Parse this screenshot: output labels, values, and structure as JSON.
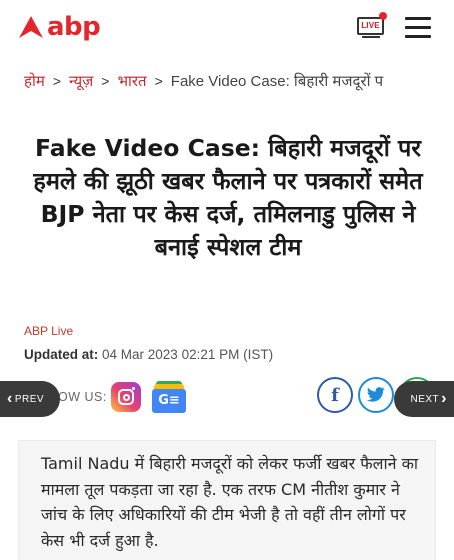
{
  "header": {
    "logo_text": "abp",
    "live_label": "LIVE",
    "brand_color": "#e3262b",
    "menu_icon": "hamburger-menu-icon"
  },
  "breadcrumb": {
    "items": [
      "होम",
      "न्यूज़",
      "भारत",
      "Fake Video Case: बिहारी मजदूरों प"
    ],
    "separator": ">"
  },
  "article": {
    "headline": "Fake Video Case: बिहारी मजदूरों पर हमले की झूठी खबर फैलाने पर पत्रकारों समेत BJP नेता पर केस दर्ज, तमिलनाडु पुलिस ने बनाई स्पेशल टीम",
    "source": "ABP Live",
    "updated_label": "Updated at:",
    "updated_value": "04 Mar 2023 02:21 PM (IST)"
  },
  "follow": {
    "label": "OW US:",
    "icons": [
      "instagram-icon",
      "google-news-icon"
    ]
  },
  "share": {
    "facebook": "f",
    "twitter": "twitter-icon",
    "whatsapp": "whatsapp-icon"
  },
  "nav": {
    "prev_label": "PREV",
    "next_label": "NEXT"
  },
  "summary": {
    "text": "Tamil Nadu में बिहारी मजदूरों को लेकर फर्जी खबर फैलाने का मामला तूल पकड़ता जा रहा है. एक तरफ CM नीतीश कुमार ने जांच के लिए अधिकारियों की टीम भेजी है तो वहीं तीन लोगों पर केस भी दर्ज हुआ है."
  }
}
